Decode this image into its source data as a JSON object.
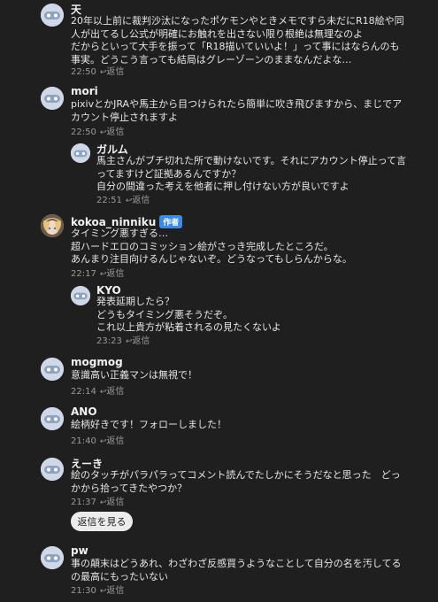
{
  "colors": {
    "background": "#1f1f1f",
    "author_badge": "#3b8ae8"
  },
  "reply_label": "返信",
  "author_badge": "作者",
  "see_replies": "返信を見る",
  "comments": [
    {
      "name": "天",
      "lines": [
        "20年以上前に裁判沙汰になったポケモンやときメモですら未だにR18絵や同",
        "人が出てるし公式が明確にお触れを出さない限り根絶は無理なのよ",
        "だからといって大手を振って「R18描いていいよ！」って事にはならんのも",
        "事実。どうこう言っても結局はグレーゾーンのままなんだよな…"
      ],
      "time": "22:50"
    },
    {
      "name": "mori",
      "lines": [
        "pixivとかJRAや馬主から目つけられたら簡単に吹き飛びますから、まじでア",
        "カウント停止されますよ"
      ],
      "time": "22:50"
    },
    {
      "name": "ガルム",
      "lines": [
        "馬主さんがブチ切れた所で動けないです。それにアカウント停止って言",
        "ってますけど証拠あるんですか？",
        "自分の間違った考えを他者に押し付けない方が良いですよ"
      ],
      "time": "22:51"
    },
    {
      "name": "kokoa_ninniku",
      "lines": [
        "タイミング悪すぎる…",
        "超ハードエロのコミッション絵がさっき完成したところだ。",
        "あんまり注目向けるんじゃないぞ。どうなってもしらんからな。"
      ],
      "time": "22:17"
    },
    {
      "name": "KYO",
      "lines": [
        "発表延期したら？",
        "どうもタイミング悪そうだぞ。",
        "これ以上貴方が粘着されるの見たくないよ"
      ],
      "time": "23:23"
    },
    {
      "name": "mogmog",
      "lines": [
        "意識高い正義マンは無視で！"
      ],
      "time": "22:14"
    },
    {
      "name": "ANO",
      "lines": [
        "絵柄好きです！フォローしました！"
      ],
      "time": "21:40"
    },
    {
      "name": "えーき",
      "lines": [
        "絵のタッチがパラパラってコメント読んでたしかにそうだなと思った　どっ",
        "かから拾ってきたやつか？"
      ],
      "time": "21:37"
    },
    {
      "name": "pw",
      "lines": [
        "事の顛末はどうあれ、わざわざ反感買うようなことして自分の名を汚してる",
        "の最高にもったいない"
      ],
      "time": "21:30"
    }
  ]
}
